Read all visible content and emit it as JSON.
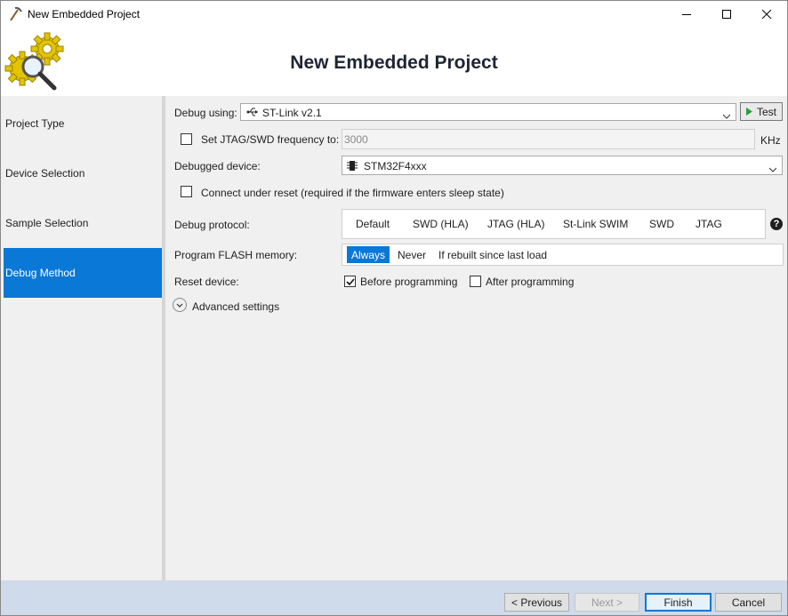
{
  "window": {
    "title": "New Embedded Project",
    "controls": [
      "minimize-icon",
      "maximize-icon",
      "close-icon"
    ]
  },
  "header": {
    "title": "New Embedded Project",
    "logo_icon": "gears-magnifier-icon"
  },
  "sidebar": {
    "items": [
      {
        "label": "Project Type",
        "active": false
      },
      {
        "label": "Device Selection",
        "active": false
      },
      {
        "label": "Sample Selection",
        "active": false
      },
      {
        "label": "Debug Method",
        "active": true
      }
    ]
  },
  "debug_using": {
    "label": "Debug using:",
    "value": "ST-Link v2.1",
    "icon": "usb-icon",
    "test_label": "Test",
    "test_icon": "play-icon"
  },
  "jtag_freq": {
    "label": "Set JTAG/SWD frequency to:",
    "checked": false,
    "value": "3000",
    "unit": "KHz"
  },
  "debugged_device": {
    "label": "Debugged device:",
    "value": "STM32F4xxx",
    "icon": "chip-icon"
  },
  "connect_reset": {
    "label": "Connect under reset (required if the firmware enters sleep state)",
    "checked": false
  },
  "debug_protocol": {
    "label": "Debug protocol:",
    "options": [
      "Default",
      "SWD (HLA)",
      "JTAG (HLA)",
      "St-Link SWIM",
      "SWD",
      "JTAG"
    ],
    "help": "?"
  },
  "program_flash": {
    "label": "Program FLASH memory:",
    "options": [
      "Always",
      "Never",
      "If rebuilt since last load"
    ],
    "selected": "Always"
  },
  "reset_device": {
    "label": "Reset device:",
    "before": {
      "label": "Before programming",
      "checked": true
    },
    "after": {
      "label": "After programming",
      "checked": false
    }
  },
  "advanced": {
    "label": "Advanced settings"
  },
  "footer": {
    "previous": "< Previous",
    "next": "Next >",
    "finish": "Finish",
    "cancel": "Cancel"
  },
  "colors": {
    "accent": "#0a78d7",
    "footer_bg": "#cfdaea",
    "panel_bg": "#f0f0f0"
  }
}
